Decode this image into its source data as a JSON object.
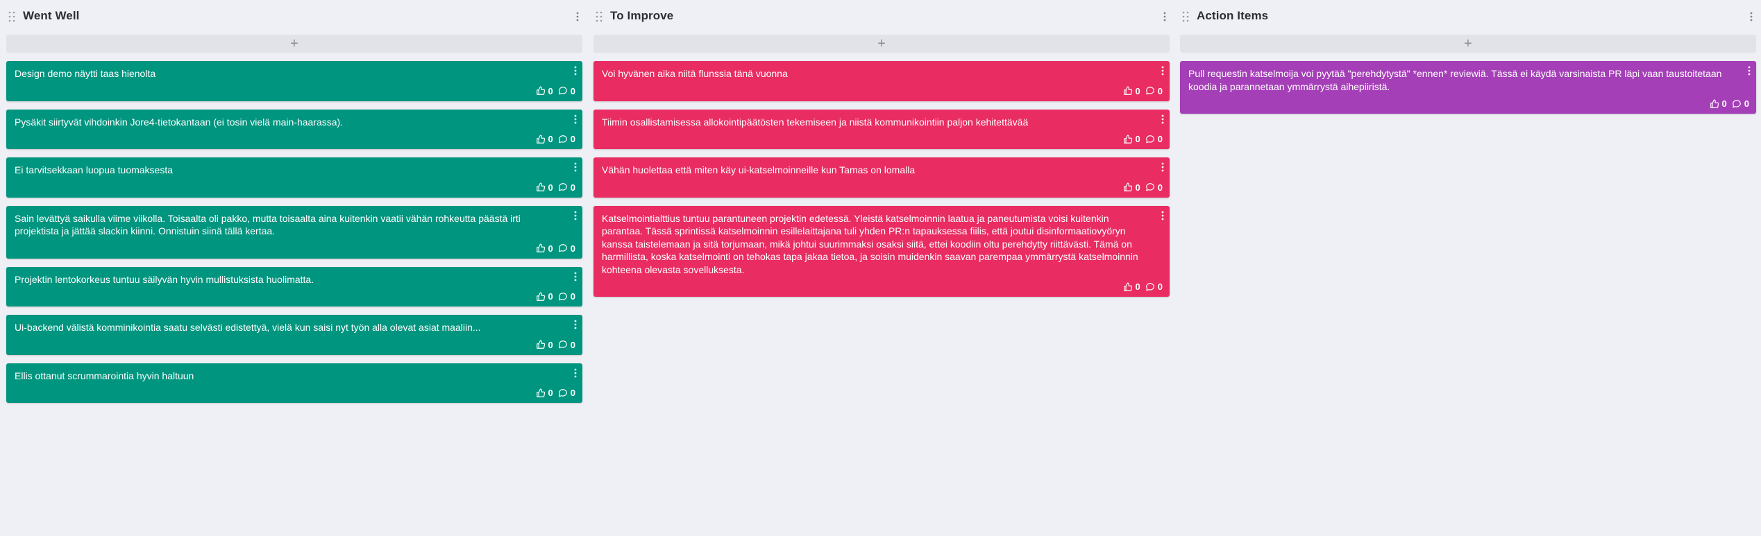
{
  "columns": [
    {
      "title": "Went Well",
      "add_label": "+",
      "card_color": "#00957f",
      "cards": [
        {
          "text": "Design demo näytti taas hienolta",
          "likes": "0",
          "comments": "0"
        },
        {
          "text": "Pysäkit siirtyvät vihdoinkin Jore4-tietokantaan (ei tosin vielä main-haarassa).",
          "likes": "0",
          "comments": "0"
        },
        {
          "text": "Ei tarvitsekkaan luopua tuomaksesta",
          "likes": "0",
          "comments": "0"
        },
        {
          "text": "Sain levättyä saikulla viime viikolla. Toisaalta oli pakko, mutta toisaalta aina kuitenkin vaatii vähän rohkeutta päästä irti projektista ja jättää slackin kiinni. Onnistuin siinä tällä kertaa.",
          "likes": "0",
          "comments": "0"
        },
        {
          "text": "Projektin lentokorkeus tuntuu säilyvän hyvin mullistuksista huolimatta.",
          "likes": "0",
          "comments": "0"
        },
        {
          "text": "Ui-backend välistä komminikointia saatu selvästi edistettyä, vielä kun saisi nyt työn alla olevat asiat maaliin...",
          "likes": "0",
          "comments": "0"
        },
        {
          "text": "Ellis ottanut scrummarointia hyvin haltuun",
          "likes": "0",
          "comments": "0"
        }
      ]
    },
    {
      "title": "To Improve",
      "add_label": "+",
      "card_color": "#e92c62",
      "cards": [
        {
          "text": "Voi hyvänen aika niitä flunssia tänä vuonna",
          "likes": "0",
          "comments": "0"
        },
        {
          "text": "Tiimin osallistamisessa allokointipäätösten tekemiseen ja niistä kommunikointiin paljon kehitettävää",
          "likes": "0",
          "comments": "0"
        },
        {
          "text": "Vähän huolettaa että miten käy ui-katselmoinneille kun Tamas on lomalla",
          "likes": "0",
          "comments": "0"
        },
        {
          "text": "Katselmointialttius tuntuu parantuneen projektin edetessä. Yleistä katselmoinnin laatua ja paneutumista voisi kuitenkin parantaa. Tässä sprintissä katselmoinnin esillelaittajana tuli yhden PR:n tapauksessa fiilis, että joutui disinformaatiovyöryn kanssa taistelemaan ja sitä torjumaan, mikä johtui suurimmaksi osaksi siitä, ettei koodiin oltu perehdytty riittävästi. Tämä on harmillista, koska katselmointi on tehokas tapa jakaa tietoa, ja soisin muidenkin saavan parempaa ymmärrystä katselmoinnin kohteena olevasta sovelluksesta.",
          "likes": "0",
          "comments": "0"
        }
      ]
    },
    {
      "title": "Action Items",
      "add_label": "+",
      "card_color": "#a43fb7",
      "cards": [
        {
          "text": "Pull requestin katselmoija voi pyytää \"perehdytystä\" *ennen* reviewiä. Tässä ei käydä varsinaista PR läpi vaan taustoitetaan koodia ja parannetaan ymmärrystä aihepiiristä.",
          "likes": "0",
          "comments": "0"
        }
      ]
    }
  ],
  "icons": {
    "drag": "drag-handle-icon",
    "menu": "more-vertical-icon",
    "like": "thumbs-up-icon",
    "comment": "comment-icon"
  },
  "colors": {
    "background": "#eff0f5",
    "went_well": "#00957f",
    "to_improve": "#e92c62",
    "action_items": "#a43fb7"
  }
}
